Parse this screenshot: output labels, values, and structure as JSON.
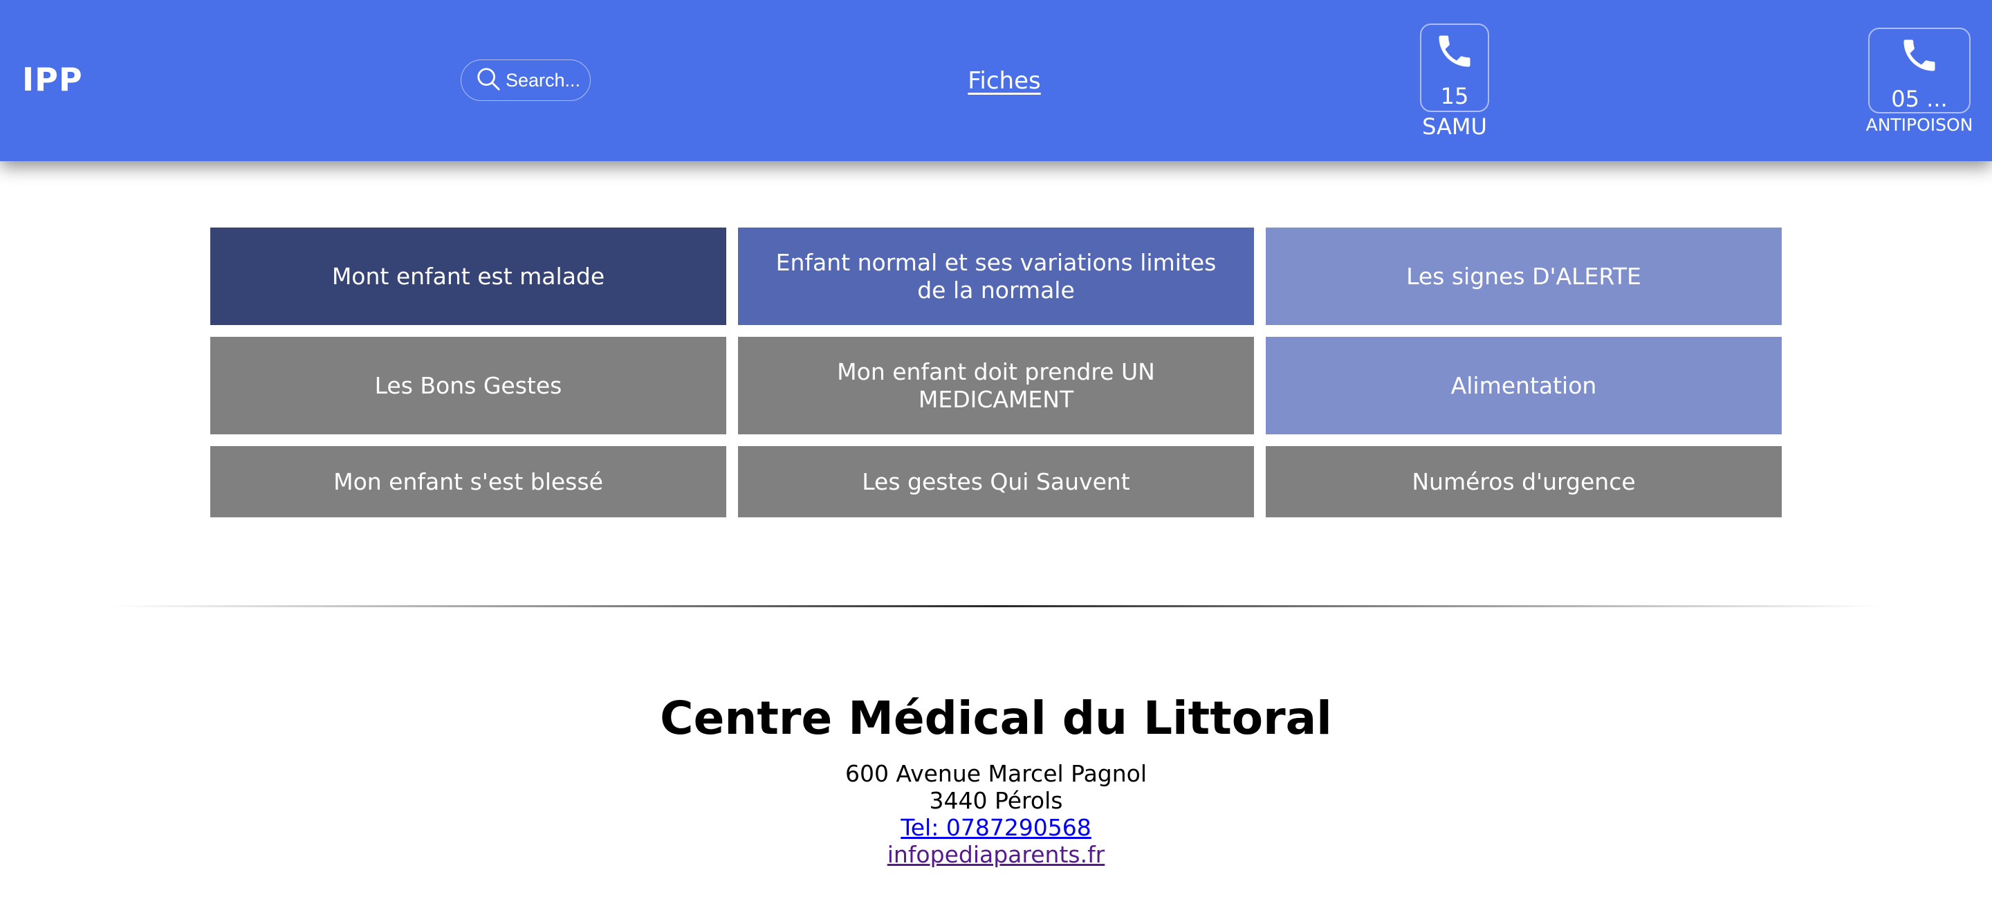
{
  "header": {
    "brand": "IPP",
    "search": {
      "placeholder": "Search..."
    },
    "nav_link": "Fiches",
    "emergency": [
      {
        "number": "15",
        "label": "SAMU"
      },
      {
        "number": "05 ...",
        "label": "ANTIPOISON"
      }
    ]
  },
  "tiles": [
    "Mont enfant est malade",
    "Enfant normal et ses variations limites de la normale",
    "Les signes D'ALERTE",
    "Les Bons Gestes",
    "Mon enfant doit prendre UN MEDICAMENT",
    "Alimentation",
    "Mon enfant s'est blessé",
    "Les gestes Qui Sauvent",
    "Numéros d'urgence"
  ],
  "tile_colors": [
    "#354375",
    "#5467b2",
    "#7f8fcb",
    "#808080"
  ],
  "footer": {
    "title": "Centre Médical du Littoral",
    "address_line1": "600 Avenue Marcel Pagnol",
    "address_line2": "3440 Pérols",
    "phone": "Tel: 0787290568",
    "email": "infopediaparents.fr"
  }
}
